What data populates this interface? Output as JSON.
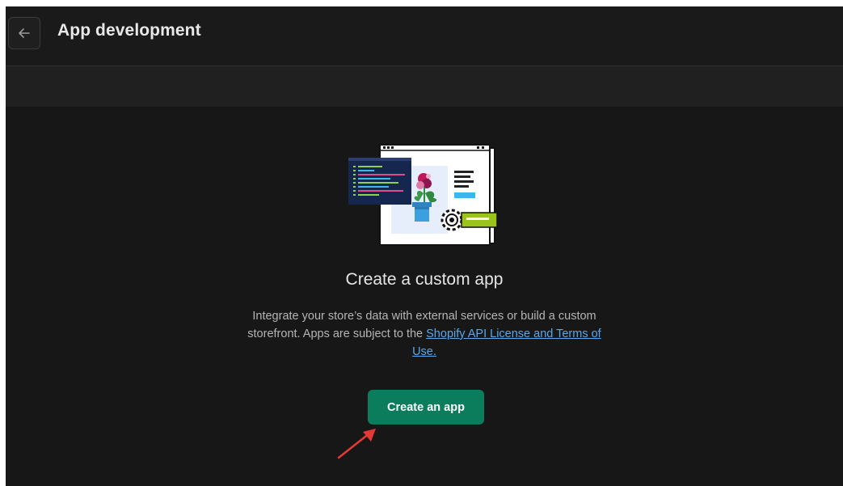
{
  "header": {
    "title": "App development",
    "back_icon": "arrow-left-icon"
  },
  "empty_state": {
    "title": "Create a custom app",
    "description_before": "Integrate your store’s data with external services or build a custom storefront. Apps are subject to the ",
    "link_text": "Shopify API License and Terms of Use.",
    "button_label": "Create an app"
  },
  "colors": {
    "background": "#1a1a1a",
    "primary_button": "#0b7d5c",
    "link": "#5aa7ea",
    "annotation_arrow": "#e53935"
  }
}
